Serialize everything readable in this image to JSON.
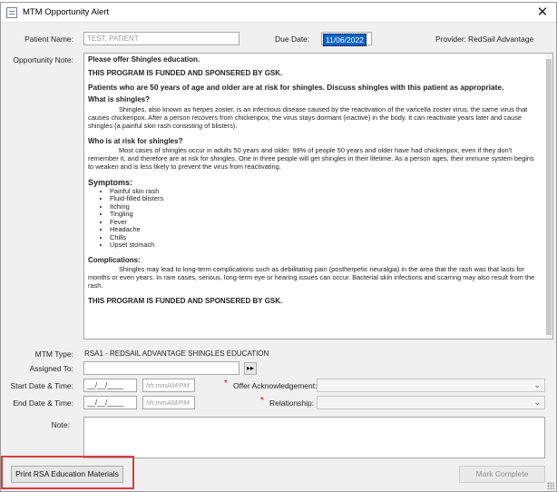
{
  "window": {
    "title": "MTM Opportunity Alert",
    "close_glyph": "✕"
  },
  "header": {
    "patient_name_label": "Patient Name:",
    "patient_name_value": "TEST, PATIENT",
    "due_date_label": "Due Date:",
    "due_date_value": "11/06/2022",
    "provider_label": "Provider:",
    "provider_value": "RedSail Advantage"
  },
  "note": {
    "label": "Opportunity Note:",
    "intro": "Please offer Shingles education.",
    "funding1": "THIS PROGRAM IS FUNDED AND SPONSERED BY GSK.",
    "risk_heading": "Patients who are 50 years of age and older are at risk for shingles. Discuss shingles with this patient as appropriate.",
    "what_heading": "What is shingles?",
    "what_text": "Shingles, also known as herpes zoster, is an infectious disease caused by the reactivation of the varicella zoster virus, the same virus that causes chickenpox. After a person recovers from chickenpox, the virus stays dormant (inactive) in the body. It can reactivate years later and cause shingles (a painful skin rash consisting of blisters).",
    "who_heading": "Who is at risk for shingles?",
    "who_text": "Most cases of shingles occur in adults 50 years and older. 99% of people 50 years and older have had chickenpox, even if they don't remember it, and therefore are at risk for shingles. One in three people will get shingles in their lifetime. As a person ages, their immune system begins to weaken and is less likely to prevent the virus from reactivating.",
    "symptoms_heading": "Symptoms:",
    "symptoms": [
      "Painful skin rash",
      "Fluid-filled blisters",
      "Itching",
      "Tingling",
      "Fever",
      "Headache",
      "Chills",
      "Upset stomach"
    ],
    "complications_heading": "Complications:",
    "complications_text": "Shingles may lead to long-term complications such as debilitating pain (postherpetic neuralgia) in the area that the rash was that lasts for months or even years. In rare cases, serious, long-term eye or hearing issues can occur. Bacterial skin infections and scarring may also result from the rash.",
    "funding2": "THIS PROGRAM IS FUNDED AND SPONSERED BY GSK."
  },
  "form": {
    "mtm_type_label": "MTM Type:",
    "mtm_type_value": "RSA1 - REDSAIL ADVANTAGE SHINGLES EDUCATION",
    "assigned_to_label": "Assigned To:",
    "assigned_to_value": "",
    "assign_arrow_glyph": "▸▸",
    "start_label": "Start Date & Time:",
    "end_label": "End Date & Time:",
    "date_placeholder": "__/__/____",
    "time_placeholder": "hh:mmAM/PM",
    "required_marker": "*",
    "offer_ack_label": "Offer Acknowledgement:",
    "relationship_label": "Relationship:",
    "chevron_glyph": "⌄",
    "note_label": "Note:"
  },
  "footer": {
    "print_button": "Print RSA Education Materials",
    "mark_complete_button": "Mark Complete"
  },
  "colors": {
    "selection": "#0a63c9",
    "required": "#d0021b",
    "highlight_border": "#d63b3b",
    "window_bg": "#f0f0f0"
  }
}
